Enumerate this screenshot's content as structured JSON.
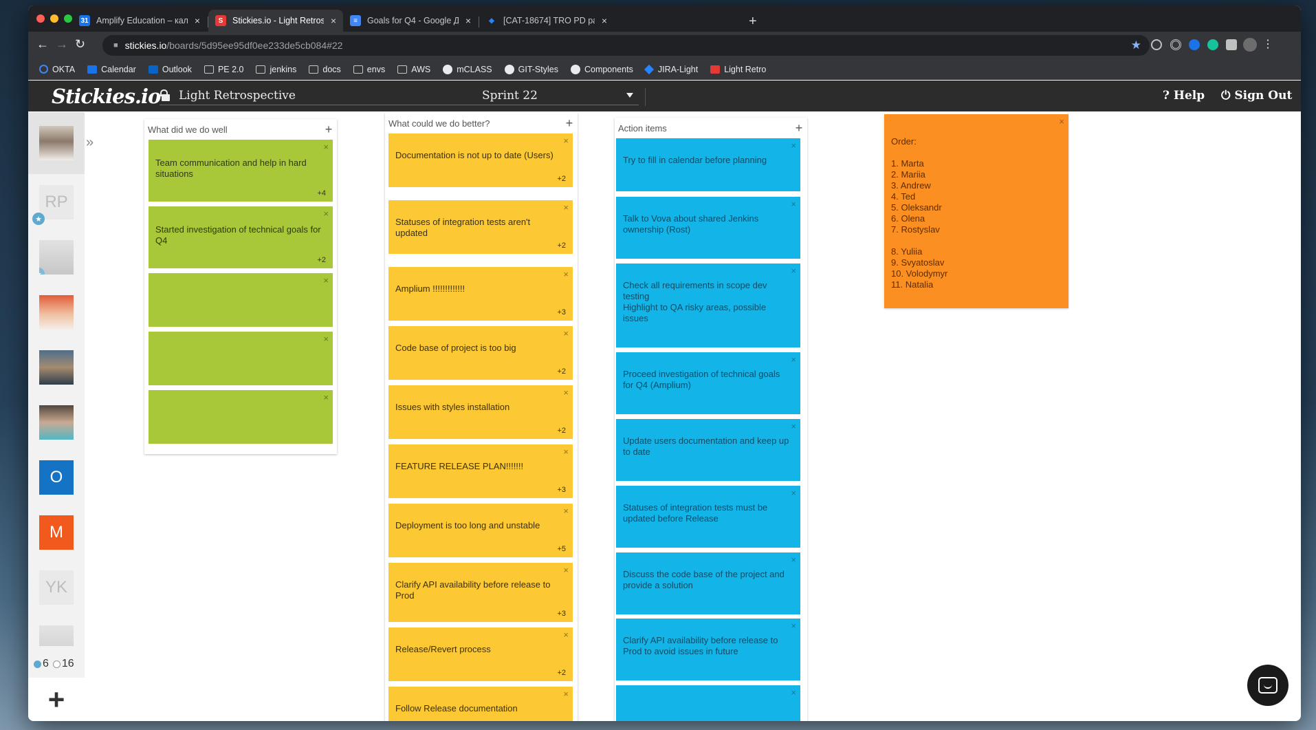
{
  "browser": {
    "tabs": [
      {
        "title": "Amplify Education – календар",
        "favicon_color": "#1a73e8",
        "favicon_char": "31"
      },
      {
        "title": "Stickies.io - Light Retrospectiv",
        "favicon_color": "#e53935",
        "favicon_char": "S"
      },
      {
        "title": "Goals for Q4 - Google Докуме",
        "favicon_color": "#4285f4",
        "favicon_char": "≡"
      },
      {
        "title": "[CAT-18674] TRO PD page: di",
        "favicon_color": "#2684ff",
        "favicon_char": "◆"
      }
    ],
    "url_host": "stickies.io",
    "url_path": "/boards/5d95ee95df0ee233de5cb084#22",
    "bookmarks": [
      "OKTA",
      "Calendar",
      "Outlook",
      "PE 2.0",
      "jenkins",
      "docs",
      "envs",
      "AWS",
      "mCLASS",
      "GIT-Styles",
      "Components",
      "JIRA-Light",
      "Light Retro"
    ]
  },
  "app": {
    "logo": "Stickies.io",
    "board_title": "Light Retrospective",
    "sprint": "Sprint 22",
    "help": "Help",
    "signout": "Sign Out",
    "help_glyph": "?",
    "signout_glyph": "⏻"
  },
  "sidebar": {
    "avatars": [
      {
        "type": "photo",
        "label": ""
      },
      {
        "type": "initials",
        "label": "RP",
        "starred": true
      },
      {
        "type": "photo-faded",
        "label": "",
        "starred": true
      },
      {
        "type": "photo",
        "label": ""
      },
      {
        "type": "photo",
        "label": ""
      },
      {
        "type": "photo",
        "label": ""
      },
      {
        "type": "initials",
        "label": "O",
        "color": "#1473c4"
      },
      {
        "type": "initials",
        "label": "M",
        "color": "#f25a1d"
      },
      {
        "type": "initials",
        "label": "YK"
      },
      {
        "type": "photo-faded",
        "label": ""
      }
    ],
    "online": "6",
    "offline": "16",
    "add_glyph": "+",
    "collapse_glyph": "»"
  },
  "columns": [
    {
      "title": "What did we do well",
      "stickies": [
        {
          "text": "Team communication and help in hard situations",
          "votes": "+4"
        },
        {
          "text": "Started investigation of technical goals for Q4",
          "votes": "+2"
        },
        {
          "text": "",
          "votes": ""
        },
        {
          "text": "",
          "votes": ""
        },
        {
          "text": "",
          "votes": ""
        }
      ]
    },
    {
      "title": "What could we do better?",
      "stickies": [
        {
          "text": "Documentation is not up to date (Users)",
          "votes": "+2"
        },
        {
          "text": "Statuses of integration tests aren't updated",
          "votes": "+2"
        },
        {
          "text": "Amplium !!!!!!!!!!!!!",
          "votes": "+3"
        },
        {
          "text": "Code base of project is too big",
          "votes": "+2"
        },
        {
          "text": "Issues with styles installation",
          "votes": "+2"
        },
        {
          "text": "FEATURE RELEASE PLAN!!!!!!!",
          "votes": "+3"
        },
        {
          "text": "Deployment is too long and unstable",
          "votes": "+5"
        },
        {
          "text": "Clarify API availability before release to Prod",
          "votes": "+3"
        },
        {
          "text": "Release/Revert process",
          "votes": "+2"
        },
        {
          "text": "Follow Release documentation",
          "votes": ""
        }
      ]
    },
    {
      "title": "Action items",
      "stickies": [
        {
          "text": "Try to fill in calendar before planning",
          "votes": ""
        },
        {
          "text": "Talk to Vova about shared Jenkins ownership (Rost)",
          "votes": ""
        },
        {
          "text": "Check all requirements in scope dev testing\nHighlight to QA risky areas, possible issues",
          "votes": ""
        },
        {
          "text": "Proceed investigation of technical goals for Q4 (Amplium)",
          "votes": ""
        },
        {
          "text": "Update users documentation and keep up to date",
          "votes": ""
        },
        {
          "text": "Statuses of integration tests must be updated before Release",
          "votes": ""
        },
        {
          "text": "Discuss the code base of the project and provide a solution",
          "votes": ""
        },
        {
          "text": "Clarify API availability before release to Prod to avoid issues in future",
          "votes": ""
        },
        {
          "text": "",
          "votes": ""
        }
      ]
    }
  ],
  "order_sticky": {
    "title": "Order:",
    "lines": [
      "1. Marta",
      "2. Mariia",
      "3. Andrew",
      "4. Ted",
      "5. Oleksandr",
      "6. Olena",
      "7. Rostyslav",
      "",
      "8. Yuliia",
      "9. Svyatoslav",
      "10. Volodymyr",
      "11. Natalia"
    ]
  },
  "glyphs": {
    "close": "×",
    "plus": "+"
  }
}
